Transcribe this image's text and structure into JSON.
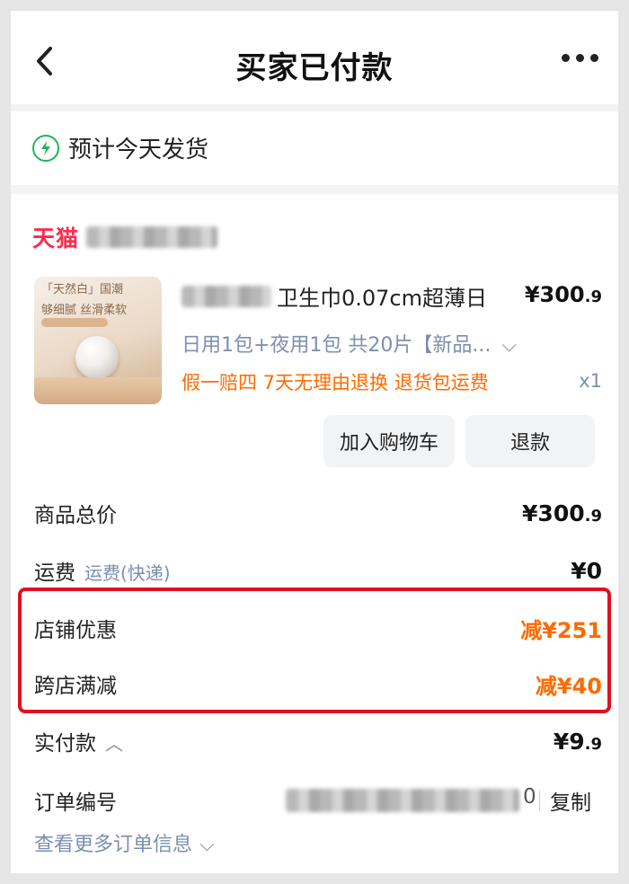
{
  "nav": {
    "title": "买家已付款",
    "back_icon": "chevron-left-icon",
    "more_icon": "more-icon"
  },
  "shipping": {
    "text": "预计今天发货",
    "icon": "lightning-icon",
    "icon_color": "#1fb45a"
  },
  "shop": {
    "brand": "天猫",
    "brand_color": "#ff2a4b"
  },
  "product": {
    "name": "卫生巾0.07cm超薄日",
    "price_main": "¥300",
    "price_dec": ".9",
    "sku": "日用1包+夜用1包 共20片【新品...",
    "promo": "假一赔四  7天无理由退换  退货包运费",
    "qty": "x1",
    "thumb_text_1": "「天然白」国潮",
    "thumb_text_2": "够细腻 丝滑柔软"
  },
  "buttons": {
    "cart": "加入购物车",
    "refund": "退款"
  },
  "summary": {
    "goods_total_label": "商品总价",
    "goods_total_main": "¥300",
    "goods_total_dec": ".9",
    "shipping_label": "运费",
    "shipping_sub": "运费(快递)",
    "shipping_value": "¥0",
    "store_discount_label": "店铺优惠",
    "store_discount_value": "减¥251",
    "cross_discount_label": "跨店满减",
    "cross_discount_value": "减¥40",
    "paid_label": "实付款",
    "paid_main": "¥9",
    "paid_dec": ".9"
  },
  "order": {
    "number_label": "订单编号",
    "number_tail": "0",
    "copy": "复制",
    "more_info": "查看更多订单信息"
  },
  "colors": {
    "discount": "#ff6a00",
    "highlight_border": "#e01020",
    "link_blue": "#7d8fb0"
  }
}
